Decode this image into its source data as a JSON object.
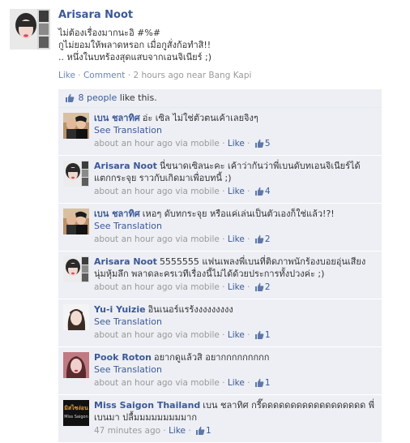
{
  "post": {
    "author": "Arisara Noot",
    "lines": [
      "ไม่ต้องเรื่องมากนะอิ #%#",
      "กูไม่ยอมให้พลาดหรอก เมื่อกูสั่งก้อทำสิ!!",
      ".. หนึ่งในบทร้องสุดแสบจากเอนจิเนียร์ ;)"
    ],
    "actions": {
      "like": "Like",
      "comment": "Comment",
      "time": "2 hours ago",
      "near": "near Bang Kapi"
    }
  },
  "likes": {
    "count_link": "8 people",
    "suffix": "like this."
  },
  "labels": {
    "see_translation": "See Translation",
    "like": "Like",
    "via": "via mobile"
  },
  "icons": {
    "thumb": "thumbs-up-icon"
  },
  "colors": {
    "link": "#3b5998",
    "panel_bg": "#edeff4",
    "meta": "#999999"
  },
  "comments": [
    {
      "author": "เบน ชลาทิศ",
      "text": "อ่ะ เซิล ไม่ใช่ตัวตนเค้าเลยจิงๆ",
      "see_translation": true,
      "time": "about an hour ago",
      "via_mobile": true,
      "likes": "5",
      "avatar": "couple"
    },
    {
      "author": "Arisara Noot",
      "text": "นี่ขนาดเซิลนะคะ เค้าว่ากันว่าพี่เบนดับทเอนจิเนียร์ได้แตกกระจุย ราวกับเกิดมาเพื่อบทนี้ ;)",
      "see_translation": false,
      "time": "about an hour ago",
      "via_mobile": true,
      "likes": "4",
      "avatar": "girl"
    },
    {
      "author": "เบน ชลาทิศ",
      "text": "เหอๆ ดับทกระจุย หรือแค่เล่นเป็นตัวเองก็ใช่แล้ว!?!",
      "see_translation": true,
      "time": "about an hour ago",
      "via_mobile": true,
      "likes": "2",
      "avatar": "couple"
    },
    {
      "author": "Arisara Noot",
      "text": "5555555 แฟนเพลงพี่เบนที่ติดภาพนักร้องบอยอุ่นเสียงนุ่มหุ้มลึก พลาดละครเวทีเรื่องนี้ไม่ได้ด้วยประการทั้งปวงค่ะ ;)",
      "see_translation": false,
      "time": "about an hour ago",
      "via_mobile": true,
      "likes": "2",
      "avatar": "girl"
    },
    {
      "author": "Yu-i Yuizie",
      "text": "อินเนอร์แรร้งงงงงงงงง",
      "see_translation": true,
      "time": "about an hour ago",
      "via_mobile": true,
      "likes": "1",
      "avatar": "woman"
    },
    {
      "author": "Pook Roton",
      "text": "อยากดูแล้วสิ อยากกกกกกกกก",
      "see_translation": true,
      "time": "about an hour ago",
      "via_mobile": true,
      "likes": "1",
      "avatar": "pink"
    },
    {
      "author": "Miss Saigon Thailand",
      "text": "เบน ชลาทิศ กรี๊ดดดดดดดดดดดดดดดดดด พี่เบนมา ปลื้มมมมมมมมมาก",
      "see_translation": false,
      "time": "47 minutes ago",
      "via_mobile": false,
      "likes": "1",
      "avatar": "logo",
      "logo_lines": [
        "มิสไซง่อน",
        "Miss Saigon"
      ]
    }
  ]
}
